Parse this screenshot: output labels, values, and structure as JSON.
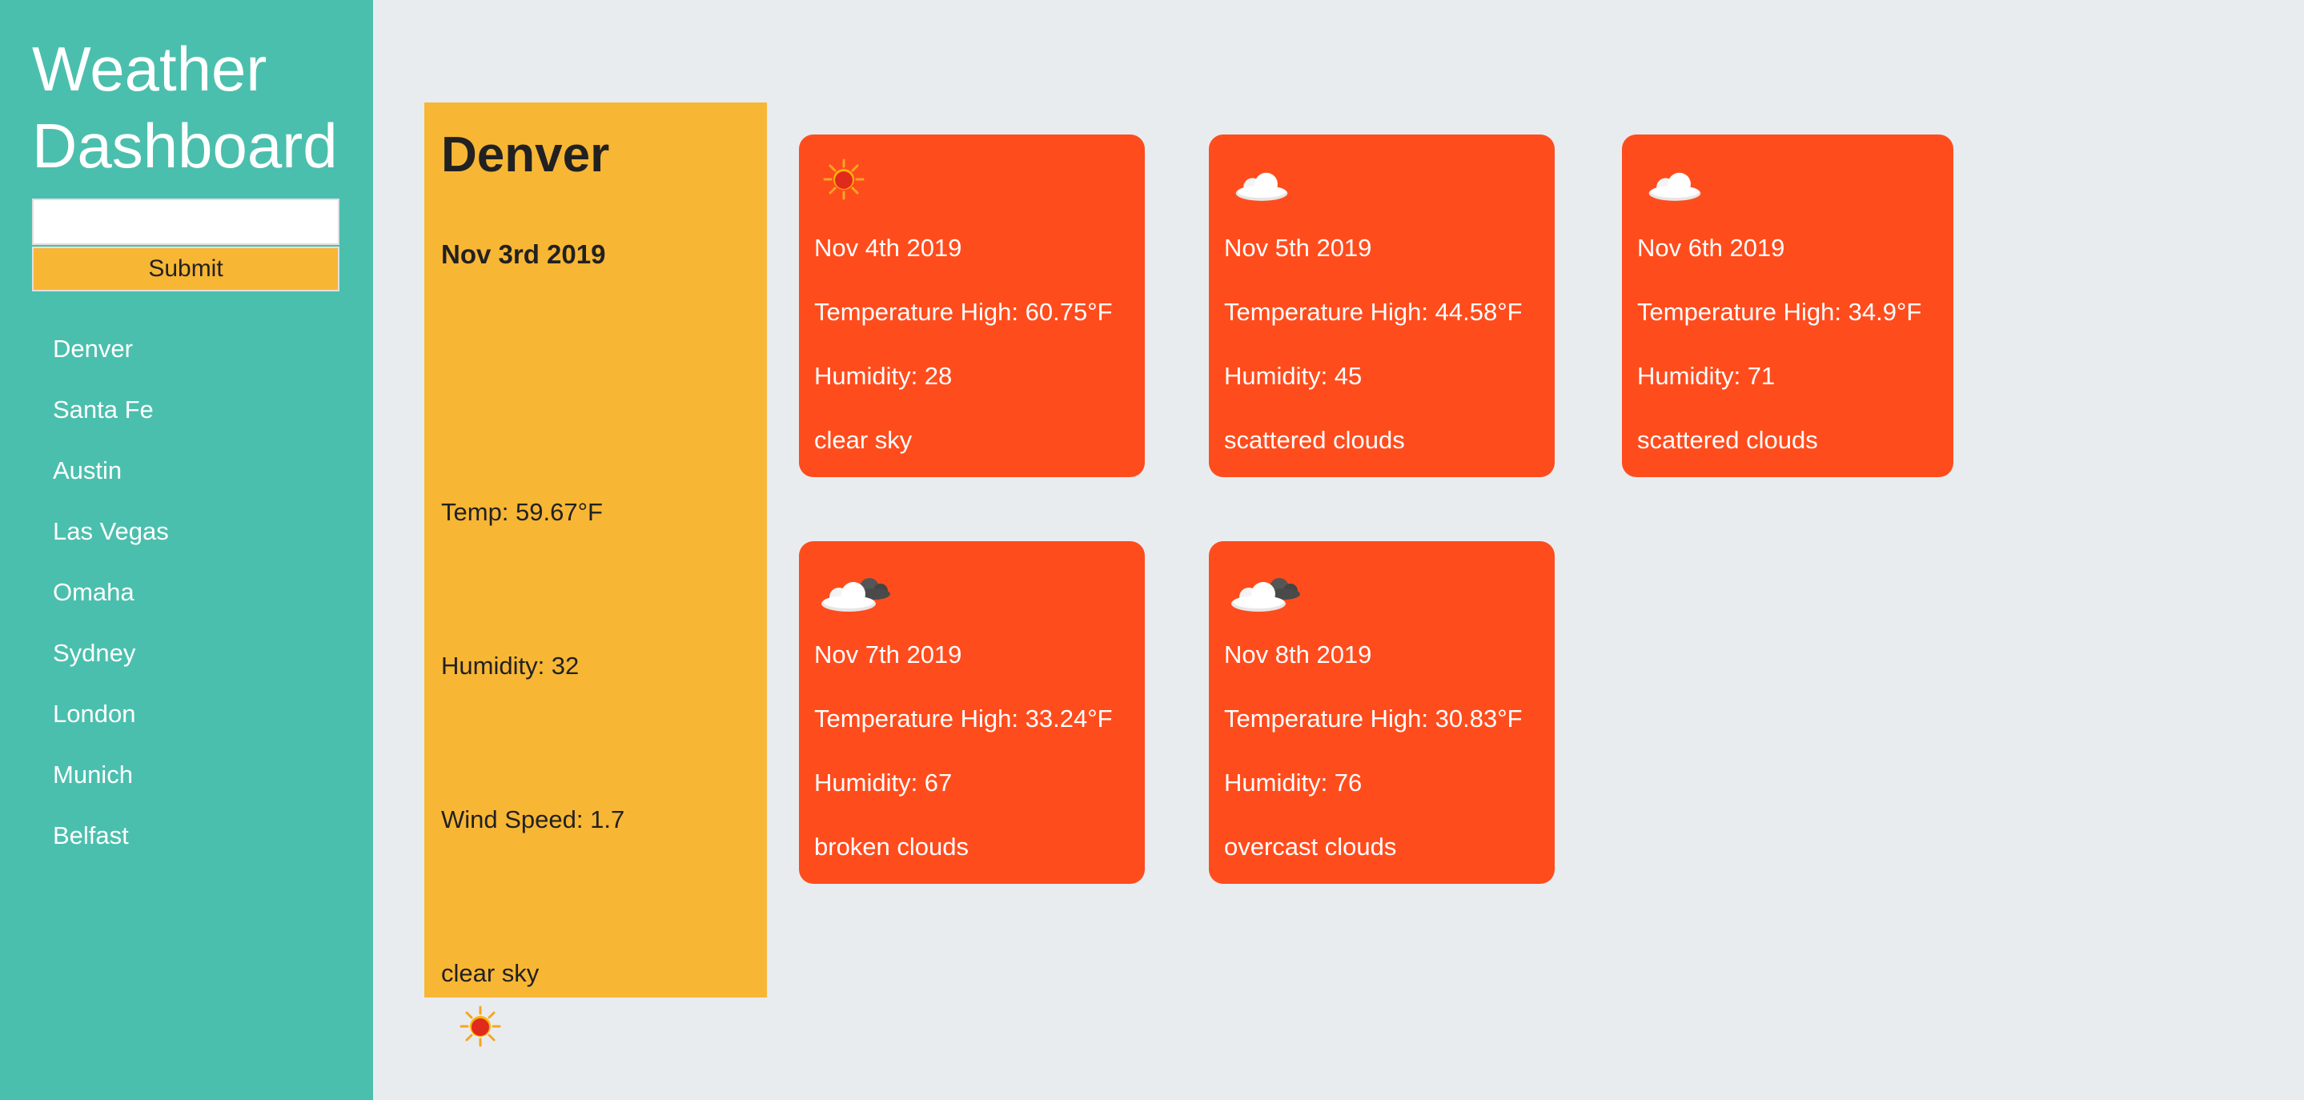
{
  "app": {
    "title": "Weather Dashboard"
  },
  "search": {
    "value": "",
    "placeholder": "",
    "submit_label": "Submit"
  },
  "cities": [
    "Denver",
    "Santa Fe",
    "Austin",
    "Las Vegas",
    "Omaha",
    "Sydney",
    "London",
    "Munich",
    "Belfast"
  ],
  "current": {
    "city": "Denver",
    "date": "Nov 3rd 2019",
    "temp": "Temp: 59.67°F",
    "humidity": "Humidity: 32",
    "wind": "Wind Speed: 1.7",
    "description": "clear sky",
    "icon": "sun-icon"
  },
  "forecast": [
    {
      "icon": "sun-icon",
      "date": "Nov 4th 2019",
      "temp_high": "Temperature High: 60.75°F",
      "humidity": "Humidity: 28",
      "description": "clear sky"
    },
    {
      "icon": "cloud-icon",
      "date": "Nov 5th 2019",
      "temp_high": "Temperature High: 44.58°F",
      "humidity": "Humidity: 45",
      "description": "scattered clouds"
    },
    {
      "icon": "cloud-icon",
      "date": "Nov 6th 2019",
      "temp_high": "Temperature High: 34.9°F",
      "humidity": "Humidity: 71",
      "description": "scattered clouds"
    },
    {
      "icon": "broken-clouds-icon",
      "date": "Nov 7th 2019",
      "temp_high": "Temperature High: 33.24°F",
      "humidity": "Humidity: 67",
      "description": "broken clouds"
    },
    {
      "icon": "broken-clouds-icon",
      "date": "Nov 8th 2019",
      "temp_high": "Temperature High: 30.83°F",
      "humidity": "Humidity: 76",
      "description": "overcast clouds"
    }
  ],
  "colors": {
    "sidebar": "#4bbfad",
    "accent": "#f8b635",
    "card": "#ff4c1d",
    "background": "#e9ecef"
  }
}
